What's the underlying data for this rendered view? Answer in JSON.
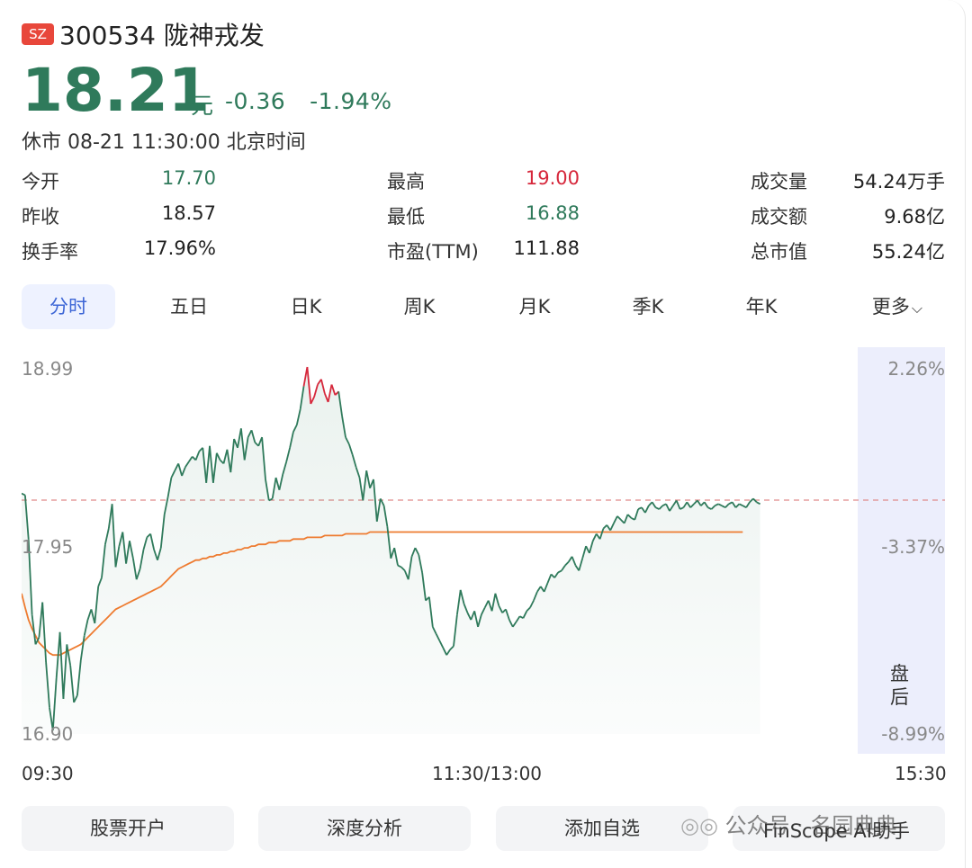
{
  "header": {
    "market_badge": "SZ",
    "stock_title": "300534 陇神戎发",
    "price": "18.21",
    "unit": "元",
    "change": "-0.36",
    "change_pct": "-1.94%",
    "status": "休市 08-21 11:30:00 北京时间"
  },
  "stats": {
    "open_label": "今开",
    "open": "17.70",
    "prev_close_label": "昨收",
    "prev_close": "18.57",
    "turnover_rate_label": "换手率",
    "turnover_rate": "17.96%",
    "high_label": "最高",
    "high": "19.00",
    "low_label": "最低",
    "low": "16.88",
    "pe_label": "市盈(TTM)",
    "pe": "111.88",
    "volume_label": "成交量",
    "volume": "54.24万手",
    "amount_label": "成交额",
    "amount": "9.68亿",
    "market_cap_label": "总市值",
    "market_cap": "55.24亿"
  },
  "tabs": [
    "分时",
    "五日",
    "日K",
    "周K",
    "月K",
    "季K",
    "年K",
    "更多"
  ],
  "chart_data": {
    "type": "line",
    "y_left_labels": [
      "18.99",
      "17.95",
      "16.90"
    ],
    "y_right_labels": [
      "2.26%",
      "-3.37%",
      "-8.99%"
    ],
    "x_labels": [
      "09:30",
      "11:30/13:00",
      "15:30"
    ],
    "after_hours_label": "盘后",
    "prev_close": 18.57,
    "ylim": [
      16.9,
      18.99
    ],
    "series": [
      {
        "color": "#2f7a5b",
        "values": [
          18.27,
          18.26,
          18.01,
          17.58,
          17.41,
          17.45,
          17.65,
          17.31,
          17.05,
          16.92,
          17.22,
          17.48,
          17.1,
          17.41,
          17.29,
          17.08,
          17.12,
          17.32,
          17.46,
          17.55,
          17.61,
          17.53,
          17.74,
          17.79,
          17.98,
          18.07,
          18.21,
          17.85,
          17.97,
          18.05,
          17.87,
          18.0,
          17.9,
          17.78,
          17.84,
          17.95,
          18.02,
          18.04,
          17.95,
          17.89,
          17.96,
          18.15,
          18.25,
          18.36,
          18.4,
          18.44,
          18.37,
          18.42,
          18.45,
          18.48,
          18.46,
          18.51,
          18.53,
          18.33,
          18.54,
          18.33,
          18.5,
          18.46,
          18.44,
          18.52,
          18.39,
          18.58,
          18.53,
          18.64,
          18.46,
          18.59,
          18.63,
          18.56,
          18.54,
          18.59,
          18.35,
          18.23,
          18.24,
          18.36,
          18.29,
          18.38,
          18.45,
          18.53,
          18.62,
          18.66,
          18.75,
          18.88,
          18.99,
          18.78,
          18.82,
          18.89,
          18.92,
          18.84,
          18.79,
          18.89,
          18.83,
          18.85,
          18.71,
          18.59,
          18.55,
          18.49,
          18.42,
          18.36,
          18.23,
          18.4,
          18.3,
          18.35,
          18.11,
          18.24,
          18.2,
          18.08,
          17.9,
          17.96,
          17.86,
          17.85,
          17.83,
          17.78,
          17.91,
          17.96,
          17.92,
          17.82,
          17.66,
          17.68,
          17.51,
          17.47,
          17.43,
          17.39,
          17.35,
          17.38,
          17.4,
          17.58,
          17.72,
          17.64,
          17.59,
          17.55,
          17.6,
          17.51,
          17.58,
          17.62,
          17.66,
          17.6,
          17.7,
          17.63,
          17.59,
          17.61,
          17.55,
          17.51,
          17.54,
          17.57,
          17.56,
          17.6,
          17.62,
          17.66,
          17.71,
          17.74,
          17.71,
          17.76,
          17.81,
          17.79,
          17.82,
          17.83,
          17.86,
          17.88,
          17.91,
          17.86,
          17.83,
          17.9,
          17.97,
          17.93,
          18.0,
          18.04,
          18.01,
          18.07,
          18.09,
          18.06,
          18.1,
          18.14,
          18.12,
          18.1,
          18.15,
          18.13,
          18.12,
          18.18,
          18.19,
          18.16,
          18.2,
          18.22,
          18.19,
          18.18,
          18.2,
          18.21,
          18.17,
          18.2,
          18.23,
          18.18,
          18.19,
          18.22,
          18.19,
          18.21,
          18.23,
          18.2,
          18.22,
          18.19,
          18.18,
          18.2,
          18.21,
          18.2,
          18.19,
          18.21,
          18.22,
          18.19,
          18.21,
          18.2,
          18.19,
          18.22,
          18.24,
          18.22,
          18.21
        ]
      },
      {
        "color": "#ee7b30",
        "values": [
          17.7,
          17.62,
          17.55,
          17.5,
          17.46,
          17.42,
          17.4,
          17.38,
          17.36,
          17.35,
          17.35,
          17.35,
          17.36,
          17.37,
          17.38,
          17.39,
          17.4,
          17.41,
          17.43,
          17.45,
          17.47,
          17.49,
          17.51,
          17.53,
          17.55,
          17.57,
          17.59,
          17.61,
          17.62,
          17.63,
          17.64,
          17.65,
          17.66,
          17.67,
          17.68,
          17.69,
          17.7,
          17.71,
          17.72,
          17.73,
          17.74,
          17.76,
          17.78,
          17.8,
          17.82,
          17.84,
          17.85,
          17.86,
          17.87,
          17.88,
          17.89,
          17.89,
          17.9,
          17.9,
          17.91,
          17.91,
          17.92,
          17.92,
          17.93,
          17.93,
          17.94,
          17.94,
          17.95,
          17.95,
          17.96,
          17.96,
          17.97,
          17.97,
          17.98,
          17.98,
          17.98,
          17.99,
          17.99,
          17.99,
          18.0,
          18.0,
          18.0,
          18.0,
          18.01,
          18.01,
          18.01,
          18.01,
          18.02,
          18.02,
          18.02,
          18.02,
          18.02,
          18.03,
          18.03,
          18.03,
          18.03,
          18.03,
          18.03,
          18.04,
          18.04,
          18.04,
          18.04,
          18.04,
          18.04,
          18.04,
          18.05,
          18.05,
          18.05,
          18.05,
          18.05,
          18.05,
          18.05,
          18.05,
          18.05,
          18.05,
          18.05,
          18.05,
          18.05,
          18.05,
          18.05,
          18.05,
          18.05,
          18.05,
          18.05,
          18.05,
          18.05,
          18.05,
          18.05,
          18.05,
          18.05,
          18.05,
          18.05,
          18.05,
          18.05,
          18.05,
          18.05,
          18.05,
          18.05,
          18.05,
          18.05,
          18.05,
          18.05,
          18.05,
          18.05,
          18.05,
          18.05,
          18.05,
          18.05,
          18.05,
          18.05,
          18.05,
          18.05,
          18.05,
          18.05,
          18.05,
          18.05,
          18.05,
          18.05,
          18.05,
          18.05,
          18.05,
          18.05,
          18.05,
          18.05,
          18.05,
          18.05,
          18.05,
          18.05,
          18.05,
          18.05,
          18.05,
          18.05,
          18.05,
          18.05,
          18.05,
          18.05,
          18.05,
          18.05,
          18.05,
          18.05,
          18.05,
          18.05,
          18.05,
          18.05,
          18.05,
          18.05,
          18.05,
          18.05,
          18.05,
          18.05,
          18.05,
          18.05,
          18.05,
          18.05,
          18.05,
          18.05,
          18.05,
          18.05,
          18.05,
          18.05,
          18.05,
          18.05,
          18.05,
          18.05,
          18.05,
          18.05,
          18.05,
          18.05,
          18.05,
          18.05,
          18.05,
          18.05,
          18.05
        ]
      }
    ]
  },
  "buttons": [
    "股票开户",
    "深度分析",
    "添加自选"
  ],
  "watermark": "公众号 · 名园典典",
  "watermark_overlay": "FinScope AI助手"
}
